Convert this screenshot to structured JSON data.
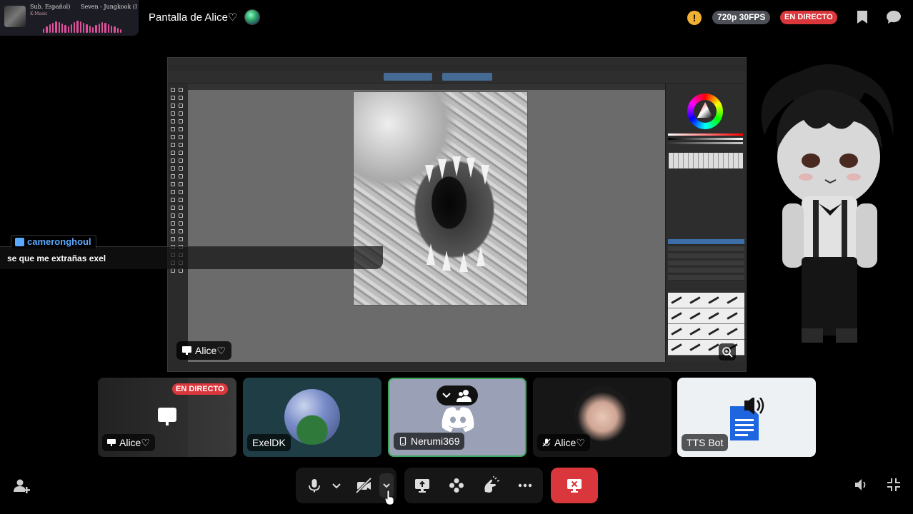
{
  "now_playing": {
    "text_left": "Sub. Español)",
    "text_right": "Seven - Jungkook (F",
    "text_sub": "K-Music"
  },
  "header": {
    "stream_title": "Pantalla de Alice♡",
    "quality": "720p 30FPS",
    "live_badge": "EN DIRECTO"
  },
  "screen": {
    "presenter_label": "Alice♡"
  },
  "chat": {
    "username": "cameronghoul",
    "message": "se que me extrañas exel"
  },
  "participants": [
    {
      "name": "Alice♡",
      "badge": "EN DIRECTO",
      "icon": "monitor-icon"
    },
    {
      "name": "ExelDK"
    },
    {
      "name": "Nerumi369",
      "icon": "phone-icon",
      "speaking": true
    },
    {
      "name": "Alice♡",
      "icon": "mic-muted-icon"
    },
    {
      "name": "TTS Bot"
    }
  ],
  "controls": {
    "icons": [
      "microphone-icon",
      "chevron-down-icon",
      "camera-off-icon",
      "chevron-down-icon",
      "share-screen-icon",
      "activities-icon",
      "soundboard-icon",
      "more-icon",
      "leave-call-icon"
    ]
  },
  "colors": {
    "live_red": "#da373c",
    "quality_bg": "#4e5058",
    "speaking_green": "#3ba55c",
    "warning": "#f0b132",
    "link_blue": "#5aa9ff"
  }
}
